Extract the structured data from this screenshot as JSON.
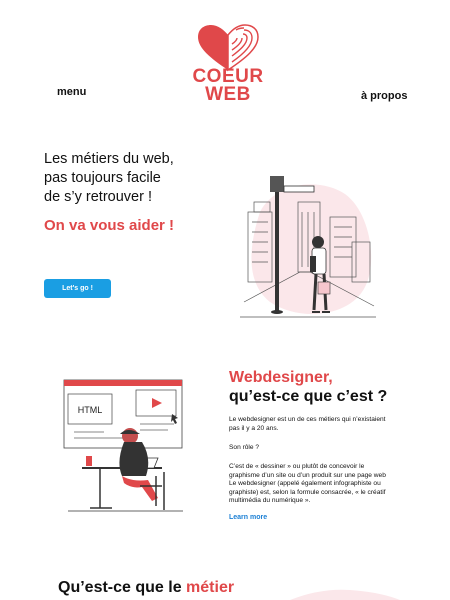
{
  "nav": {
    "menu_label": "menu",
    "about_label": "à propos"
  },
  "logo": {
    "line1": "COEUR",
    "line2": "WEB",
    "color": "#e0484a"
  },
  "hero": {
    "title_lines": [
      "Les métiers du web,",
      "pas toujours facile",
      "de s’y retrouver !"
    ],
    "tagline": "On va vous aider !",
    "button_label": "Let's go !",
    "button_color": "#1a9ee3",
    "illustration_icon": "city-street-illustration"
  },
  "webdesigner": {
    "title_red": "Webdesigner,",
    "title_black": "qu’est-ce que c’est ?",
    "para1": "Le webdesigner est un de ces métiers qui n’existaient pas il y a 20 ans.",
    "para2": "Son rôle ?",
    "para3": "C’est de « dessiner » ou plutôt de concevoir le graphisme d’un site ou d’un produit sur une page web Le webdesigner (appelé également infographiste ou graphiste) est, selon la formule consacrée, « le créatif multimédia du numérique ».",
    "learn_more": "Learn more",
    "illustration_text": "HTML",
    "illustration_icon": "designer-at-desk-illustration"
  },
  "bottom": {
    "title_black": "Qu’est-ce que le ",
    "title_red": "métier"
  }
}
